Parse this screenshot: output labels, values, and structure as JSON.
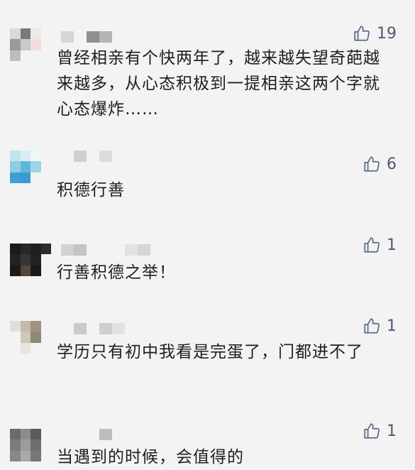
{
  "comments": [
    {
      "likes": "19",
      "text": "曾经相亲有个快两年了，越来越失望奇葩越来越多，从心态积极到一提相亲这两个字就心态爆炸……"
    },
    {
      "likes": "6",
      "text": "积德行善"
    },
    {
      "likes": "1",
      "text": "行善积德之举！"
    },
    {
      "likes": "1",
      "text": "学历只有初中我看是完蛋了，门都进不了"
    },
    {
      "likes": "1",
      "text": "当遇到的时候，会值得的"
    }
  ],
  "colors": {
    "background": "#f3f3f3",
    "like_icon": "#5a6c8a",
    "text": "#1e1e1e"
  },
  "icons": {
    "like": "thumbs-up-icon"
  }
}
